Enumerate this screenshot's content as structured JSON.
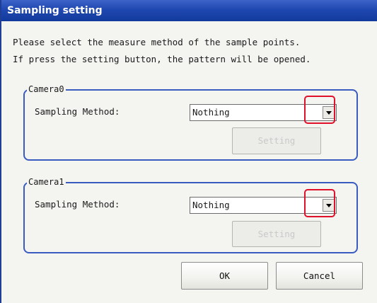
{
  "window": {
    "title": "Sampling setting"
  },
  "instructions": [
    "Please select the measure method of the sample points.",
    "If press the setting button, the pattern will be opened."
  ],
  "groups": [
    {
      "title": "Camera0",
      "field_label": "Sampling Method:",
      "selected": "Nothing",
      "setting_label": "Setting"
    },
    {
      "title": "Camera1",
      "field_label": "Sampling Method:",
      "selected": "Nothing",
      "setting_label": "Setting"
    }
  ],
  "buttons": {
    "ok": "OK",
    "cancel": "Cancel"
  },
  "colors": {
    "title_bar": "#1f48b0",
    "group_border": "#3a5cc0",
    "highlight": "#e0102a"
  }
}
